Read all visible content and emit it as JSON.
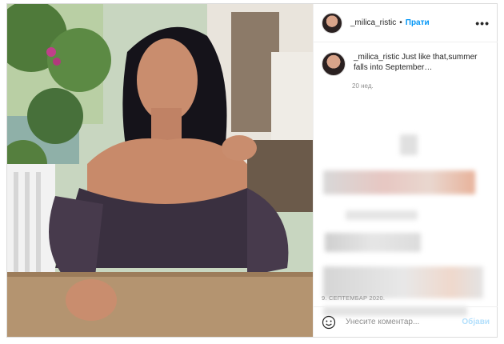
{
  "post": {
    "username": "_milica_ristic",
    "follow_label": "Прати",
    "separator": "•",
    "more_label": "•••",
    "caption_user": "_milica_ristic",
    "caption_text": " Just like that,summer falls into September…",
    "caption_age": "20 нед.",
    "date": "9. СЕПТЕМБАР 2020.",
    "comment_placeholder": "Унесите коментар...",
    "post_label": "Објави"
  },
  "colors": {
    "link": "#0095f6",
    "post_disabled": "#b2dffc",
    "muted": "#8e8e8e",
    "text": "#262626"
  }
}
